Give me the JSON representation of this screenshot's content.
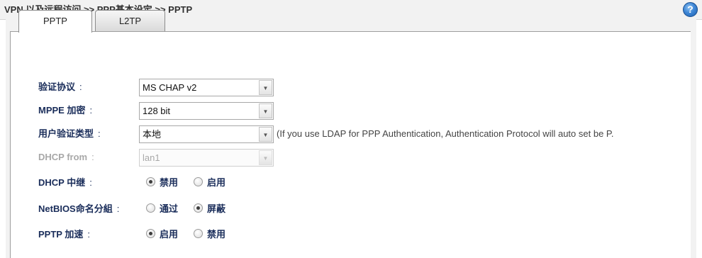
{
  "breadcrumb": "VPN 以及远程访问 >> PPP基本设定 >> PPTP",
  "help": {
    "glyph": "?"
  },
  "tabs": [
    {
      "label": "PPTP",
      "active": true
    },
    {
      "label": "L2TP",
      "active": false
    }
  ],
  "form": {
    "auth_protocol": {
      "label": "验证协议",
      "value": "MS CHAP v2"
    },
    "mppe": {
      "label": "MPPE 加密",
      "value": "128 bit"
    },
    "user_auth_type": {
      "label": "用户验证类型",
      "value": "本地",
      "hint": "(If you use LDAP for PPP Authentication, Authentication Protocol will auto set be P."
    },
    "dhcp_from": {
      "label": "DHCP from",
      "value": "lan1",
      "disabled": true
    },
    "dhcp_relay": {
      "label": "DHCP 中继",
      "options": [
        "禁用",
        "启用"
      ],
      "selected": "禁用"
    },
    "netbios": {
      "label": "NetBIOS命名分組",
      "options": [
        "通过",
        "屏蔽"
      ],
      "selected": "屏蔽"
    },
    "pptp_accel": {
      "label": "PPTP 加速",
      "options": [
        "启用",
        "禁用"
      ],
      "selected": "启用"
    },
    "colon": ":"
  },
  "colors": {
    "label": "#1a2d5a",
    "disabled": "#a8a8a8",
    "help": "#3f87d6"
  }
}
